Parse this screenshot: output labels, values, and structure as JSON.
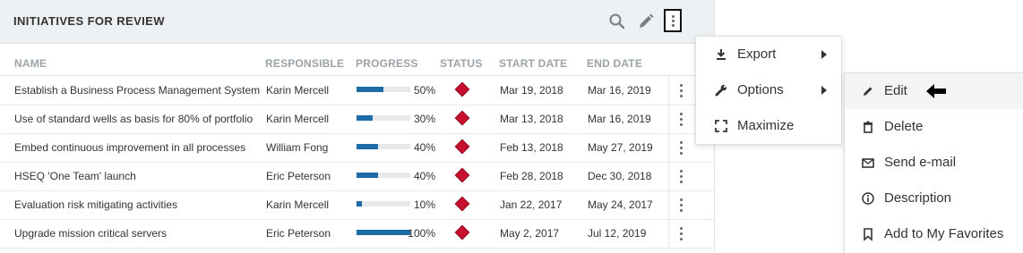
{
  "widget": {
    "title": "INITIATIVES FOR REVIEW",
    "header_icons": [
      "search-icon",
      "pencil-icon",
      "more-vertical-icon"
    ]
  },
  "table": {
    "columns": [
      "NAME",
      "RESPONSIBLE",
      "PROGRESS",
      "STATUS",
      "START DATE",
      "END DATE"
    ],
    "rows": [
      {
        "name": "Establish a Business Process Management System",
        "responsible": "Karin Mercell",
        "progress": "50%",
        "progress_value": 50,
        "start": "Mar 19, 2018",
        "end": "Mar 16, 2019"
      },
      {
        "name": "Use of standard wells as basis for 80% of portfolio",
        "responsible": "Karin Mercell",
        "progress": "30%",
        "progress_value": 30,
        "start": "Mar 13, 2018",
        "end": "Mar 16, 2019"
      },
      {
        "name": "Embed continuous improvement in all processes",
        "responsible": "William Fong",
        "progress": "40%",
        "progress_value": 40,
        "start": "Feb 13, 2018",
        "end": "May 27, 2019"
      },
      {
        "name": "HSEQ 'One Team' launch",
        "responsible": "Eric Peterson",
        "progress": "40%",
        "progress_value": 40,
        "start": "Feb 28, 2018",
        "end": "Dec 30, 2018"
      },
      {
        "name": "Evaluation risk mitigating activities",
        "responsible": "Karin Mercell",
        "progress": "10%",
        "progress_value": 10,
        "start": "Jan 22, 2017",
        "end": "May 24, 2017"
      },
      {
        "name": "Upgrade mission critical servers",
        "responsible": "Eric Peterson",
        "progress": "100%",
        "progress_value": 100,
        "start": "May 2, 2017",
        "end": "Jul 12, 2019"
      }
    ],
    "status_color": "#c8102e",
    "progress_color": "#1f6ba6"
  },
  "menu": {
    "items": [
      {
        "label": "Export",
        "icon": "download-icon"
      },
      {
        "label": "Options",
        "icon": "wrench-icon"
      },
      {
        "label": "Maximize",
        "icon": "maximize-icon"
      }
    ]
  },
  "submenu": {
    "items": [
      {
        "label": "Edit",
        "icon": "pencil-icon"
      },
      {
        "label": "Delete",
        "icon": "trash-icon"
      },
      {
        "label": "Send e-mail",
        "icon": "envelope-icon"
      },
      {
        "label": "Description",
        "icon": "info-icon"
      },
      {
        "label": "Add to My Favorites",
        "icon": "bookmark-icon"
      }
    ]
  }
}
